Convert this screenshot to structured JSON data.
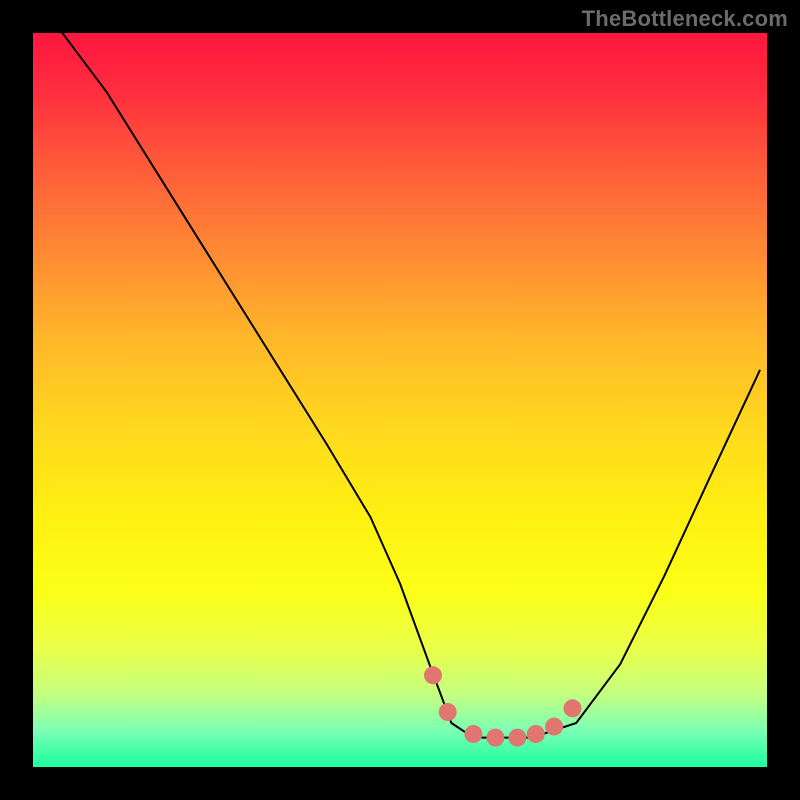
{
  "watermark": "TheBottleneck.com",
  "chart_data": {
    "type": "line",
    "title": "",
    "xlabel": "",
    "ylabel": "",
    "xlim": [
      0,
      100
    ],
    "ylim": [
      0,
      100
    ],
    "series": [
      {
        "name": "curve",
        "x": [
          4,
          10,
          20,
          30,
          40,
          46,
          50,
          54,
          57,
          60,
          63,
          68,
          74,
          80,
          86,
          92,
          99
        ],
        "y": [
          100,
          92,
          76,
          60,
          44,
          34,
          25,
          14,
          6,
          4,
          4,
          4,
          6,
          14,
          26,
          39,
          54
        ]
      },
      {
        "name": "highlight-dots",
        "x": [
          54.5,
          56.5,
          60,
          63,
          66,
          68.5,
          71,
          73.5
        ],
        "y": [
          12.5,
          7.5,
          4.5,
          4,
          4,
          4.5,
          5.5,
          8
        ]
      }
    ],
    "colors": {
      "curve": "#000000",
      "dots": "#e0766f"
    }
  }
}
